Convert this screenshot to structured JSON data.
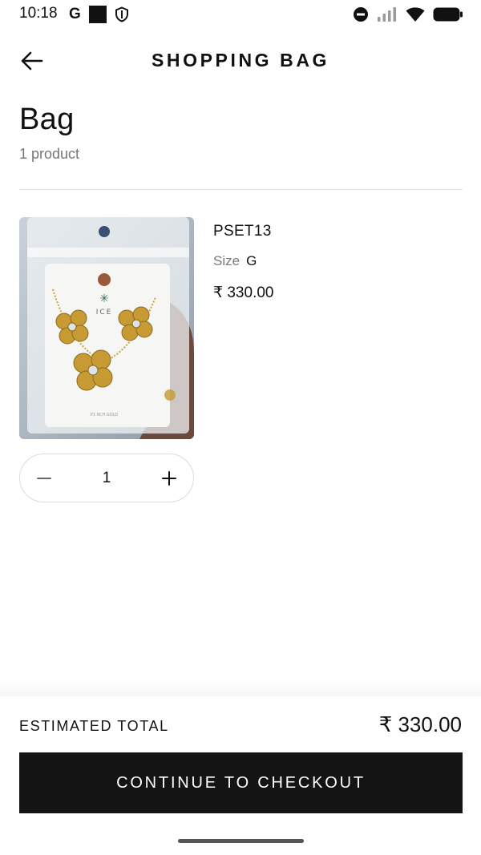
{
  "status_bar": {
    "time": "10:18",
    "g_label": "G",
    "left_icons": [
      "google-icon",
      "square-icon",
      "shield-icon"
    ],
    "right_icons": [
      "dnd-icon",
      "signal-icon",
      "wifi-icon",
      "battery-icon"
    ]
  },
  "header": {
    "title": "SHOPPING BAG",
    "back_icon": "arrow-left-icon"
  },
  "bag": {
    "title": "Bag",
    "count": "1 product"
  },
  "items": [
    {
      "name": "PSET13",
      "size_label": "Size",
      "size_value": "G",
      "price": "₹ 330.00",
      "quantity": "1",
      "image": {
        "brand_text": "ICE",
        "card_text": "P1 RCH GOLD"
      }
    }
  ],
  "footer": {
    "total_label": "ESTIMATED TOTAL",
    "total_value": "₹ 330.00",
    "checkout_label": "CONTINUE TO CHECKOUT"
  },
  "colors": {
    "primary": "#141414",
    "muted_text": "#777777",
    "divider": "#e3e3e3"
  }
}
